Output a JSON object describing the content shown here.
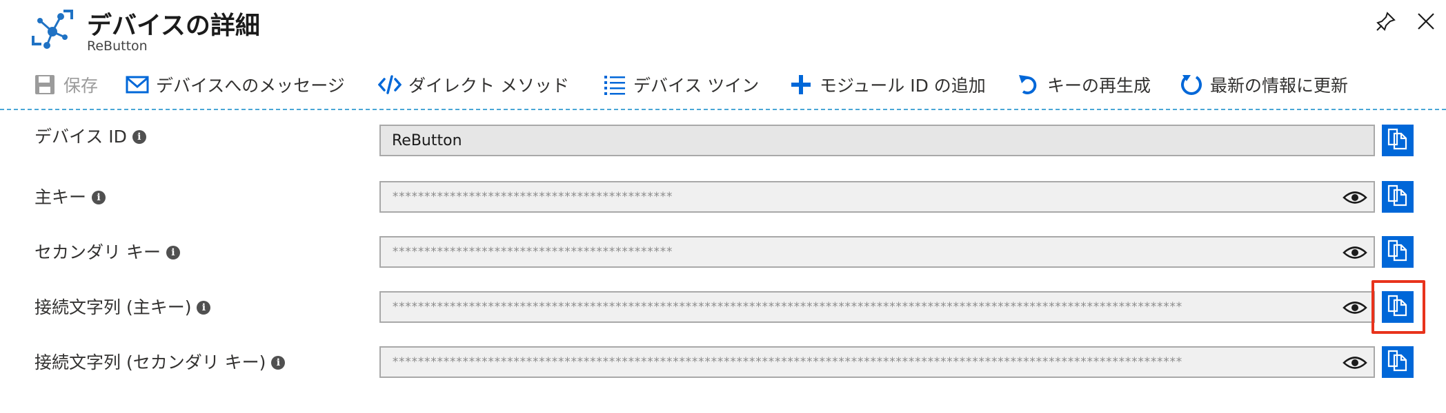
{
  "header": {
    "title": "デバイスの詳細",
    "subtitle": "ReButton"
  },
  "toolbar": {
    "save": "保存",
    "message": "デバイスへのメッセージ",
    "direct_method": "ダイレクト メソッド",
    "device_twin": "デバイス ツイン",
    "add_module": "モジュール ID の追加",
    "regenerate_keys": "キーの再生成",
    "refresh": "最新の情報に更新"
  },
  "fields": {
    "device_id": {
      "label": "デバイス ID",
      "value": "ReButton"
    },
    "primary_key": {
      "label": "主キー",
      "value": "********************************************"
    },
    "secondary_key": {
      "label": "セカンダリ キー",
      "value": "********************************************"
    },
    "conn_primary": {
      "label": "接続文字列 (主キー)",
      "value": "****************************************************************************************************************************"
    },
    "conn_secondary": {
      "label": "接続文字列 (セカンダリ キー)",
      "value": "****************************************************************************************************************************"
    }
  },
  "colors": {
    "accent": "#0067d8",
    "highlight": "#e8331c",
    "divider": "#49a6d6"
  },
  "icons": [
    "iot-hub-icon",
    "pin-icon",
    "close-icon",
    "save-icon",
    "mail-icon",
    "code-icon",
    "list-icon",
    "plus-icon",
    "redo-icon",
    "refresh-icon",
    "info-icon",
    "eye-icon",
    "copy-icon"
  ]
}
